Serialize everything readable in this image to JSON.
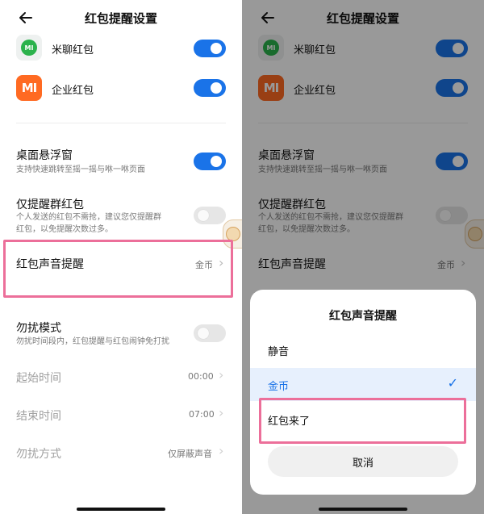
{
  "header": {
    "title": "红包提醒设置"
  },
  "apps": [
    {
      "label": "米聊红包",
      "icon": "miliao-icon",
      "icon_text": "MI",
      "enabled": true
    },
    {
      "label": "企业红包",
      "icon": "xiaomi-logo-icon",
      "icon_text": "MI",
      "enabled": true
    }
  ],
  "floating_window": {
    "label": "桌面悬浮窗",
    "desc": "支持快速跳转至摇一摇与咻一咻页面",
    "enabled": true
  },
  "group_only": {
    "label": "仅提醒群红包",
    "desc_line1": "个人发送的红包不需抢，建议您仅提醒群",
    "desc_line2": "红包，以免提醒次数过多。",
    "enabled": false
  },
  "sound": {
    "label": "红包声音提醒",
    "value": "金币"
  },
  "dnd": {
    "label": "勿扰模式",
    "desc": "勿扰时间段内，红包提醒与红包闹钟免打扰",
    "enabled": false,
    "start": {
      "label": "起始时间",
      "value": "00:00"
    },
    "end": {
      "label": "结束时间",
      "value": "07:00"
    },
    "mode": {
      "label": "勿扰方式",
      "value": "仅屏蔽声音"
    }
  },
  "sheet": {
    "title": "红包声音提醒",
    "options": [
      {
        "label": "静音",
        "selected": false
      },
      {
        "label": "金币",
        "selected": true
      },
      {
        "label": "红包来了",
        "selected": false
      }
    ],
    "cancel_label": "取消"
  },
  "colors": {
    "accent": "#1a73e8",
    "highlight": "#ec6f9a",
    "toggle_off": "#e6e6e6"
  },
  "icons": {
    "back": "arrow-left-icon",
    "chevron": "chevron-right-icon",
    "check": "checkmark-icon"
  },
  "glyphs": {
    "chevron": "›",
    "check": "✓"
  }
}
